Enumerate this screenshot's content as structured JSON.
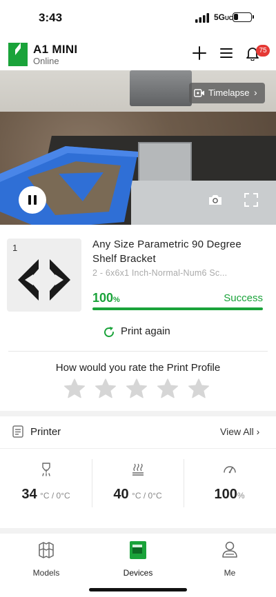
{
  "status_bar": {
    "time": "3:43",
    "network": "5G",
    "network_suffix": "UC"
  },
  "header": {
    "device_name": "A1 MINI",
    "device_status": "Online",
    "notification_count": "75"
  },
  "camera": {
    "timelapse_label": "Timelapse"
  },
  "job": {
    "thumb_index": "1",
    "title": "Any Size Parametric 90 Degree Shelf Bracket",
    "subtitle": "2 - 6x6x1 Inch-Normal-Num6 Sc...",
    "progress_value": "100",
    "progress_unit": "%",
    "progress_fraction": 1.0,
    "status": "Success",
    "print_again_label": "Print again",
    "rate_prompt": "How would you rate the Print Profile",
    "rating_stars": 5
  },
  "printer": {
    "title": "Printer",
    "view_all_label": "View All",
    "metrics": [
      {
        "icon": "nozzle-icon",
        "value": "34",
        "unit": "°C / 0°C"
      },
      {
        "icon": "heatbed-icon",
        "value": "40",
        "unit": "°C / 0°C"
      },
      {
        "icon": "speed-gauge-icon",
        "value": "100",
        "unit": "%"
      }
    ]
  },
  "tabs": [
    {
      "label": "Models",
      "icon": "models-icon"
    },
    {
      "label": "Devices",
      "icon": "devices-icon",
      "active": true
    },
    {
      "label": "Me",
      "icon": "me-icon"
    }
  ],
  "colors": {
    "accent": "#1aa33a",
    "badge": "#e53935",
    "part_blue": "#2f6fd6"
  }
}
